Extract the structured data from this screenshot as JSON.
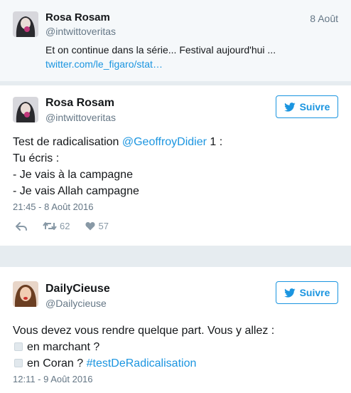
{
  "quoted": {
    "name": "Rosa Rosam",
    "handle": "@intwittoveritas",
    "date": "8 Août",
    "text": "Et on continue dans la série... Festival aujourd'hui ...",
    "link": "twitter.com/le_figaro/stat…"
  },
  "tweet1": {
    "name": "Rosa Rosam",
    "handle": "@intwittoveritas",
    "follow_label": "Suivre",
    "line1_prefix": "Test de radicalisation ",
    "line1_mention": "@GeoffroyDidier",
    "line1_suffix": " 1 :",
    "line2": "Tu écris :",
    "line3": "- Je vais à la campagne",
    "line4": "- Je vais Allah campagne",
    "timestamp": "21:45 - 8 Août 2016",
    "retweets": "62",
    "likes": "57"
  },
  "tweet2": {
    "name": "DailyCieuse",
    "handle": "@Dailycieuse",
    "follow_label": "Suivre",
    "line1": "Vous devez vous rendre quelque part. Vous y allez :",
    "option1": "en marchant ?",
    "option2_prefix": "en Coran ? ",
    "option2_hashtag": "#testDeRadicalisation",
    "timestamp": "12:11 - 9 Août 2016"
  },
  "colors": {
    "accent": "#1b95e0",
    "muted": "#657786",
    "background": "#e6ecf0"
  }
}
